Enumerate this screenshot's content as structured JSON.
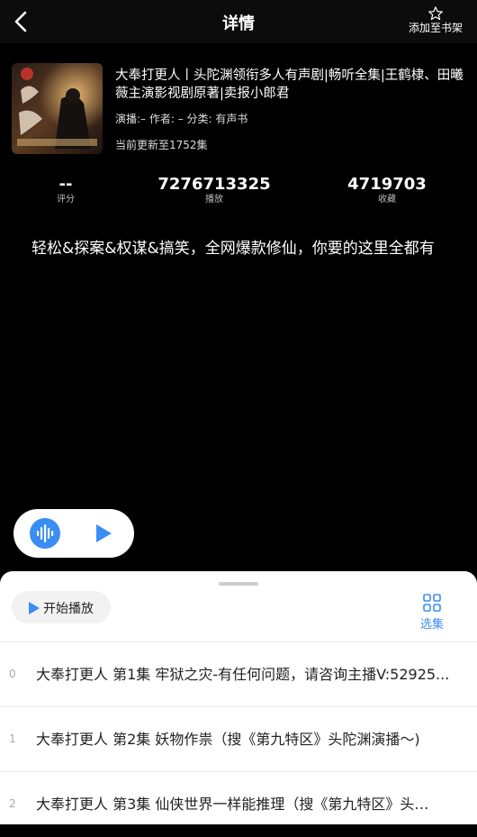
{
  "header": {
    "title": "详情",
    "bookmark_label": "添加至书架"
  },
  "book": {
    "title": "大奉打更人丨头陀渊领衔多人有声剧|畅听全集|王鹤棣、田曦薇主演影视剧原著|卖报小郎君",
    "meta": "演播:–  作者: – 分类: 有声书",
    "update": "当前更新至1752集"
  },
  "stats": [
    {
      "value": "--",
      "label": "评分"
    },
    {
      "value": "7276713325",
      "label": "播放"
    },
    {
      "value": "4719703",
      "label": "收藏"
    }
  ],
  "description": "轻松&探案&权谋&搞笑，全网爆款修仙，你要的这里全都有",
  "sheet": {
    "start_label": "开始播放",
    "episodes_label": "选集"
  },
  "episodes": [
    {
      "index": "0",
      "title": "大奉打更人 第1集 牢狱之灾-有任何问题，请咨询主播V:52925..."
    },
    {
      "index": "1",
      "title": "大奉打更人 第2集 妖物作祟（搜《第九特区》头陀渊演播～)"
    },
    {
      "index": "2",
      "title": "大奉打更人 第3集 仙侠世界一样能推理（搜《第九特区》头…"
    }
  ],
  "colors": {
    "accent": "#3a8df5",
    "background": "#000000",
    "sheet": "#ffffff"
  }
}
